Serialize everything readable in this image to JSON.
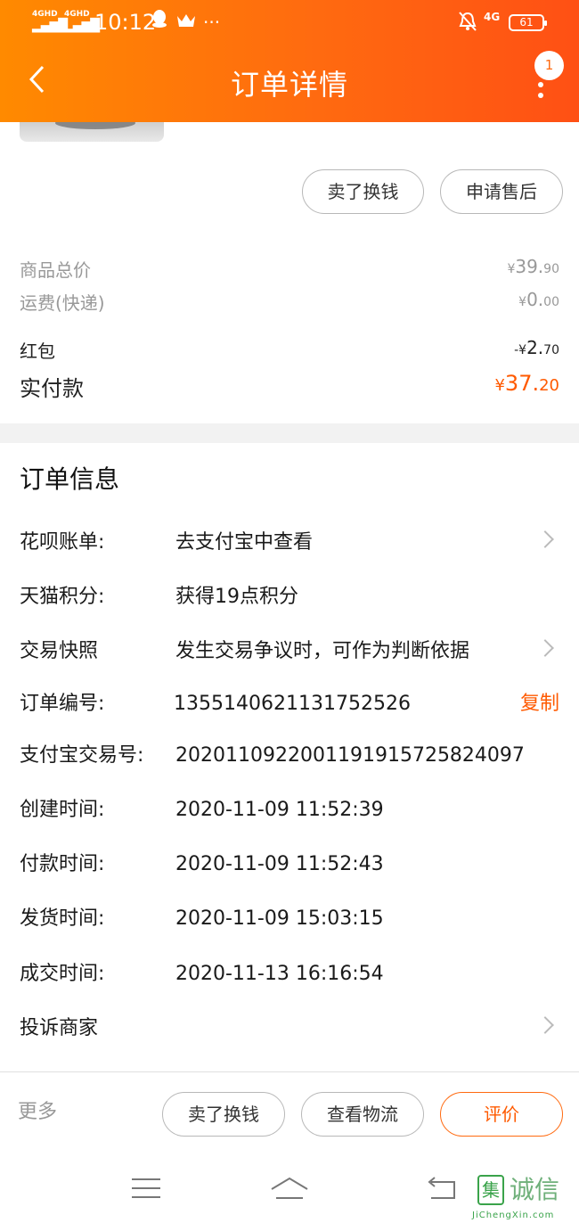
{
  "status_bar": {
    "sig1": "4GHD",
    "sig2": "4GHD",
    "time": "10:12",
    "more": "···",
    "network": "4G",
    "battery": "61"
  },
  "header": {
    "title": "订单详情",
    "back_icon": "chevron-left-icon",
    "more_icon": "vertical-dots-icon",
    "badge": "1"
  },
  "actions_top": {
    "sell_label": "卖了换钱",
    "after_sale_label": "申请售后"
  },
  "prices": {
    "goods_total_label": "商品总价",
    "goods_total_yen": "¥",
    "goods_total_int": "39.",
    "goods_total_dec": "90",
    "shipping_label": "运费(快递)",
    "shipping_yen": "¥",
    "shipping_int": "0.",
    "shipping_dec": "00",
    "redpacket_label": "红包",
    "redpacket_yen": "-¥",
    "redpacket_int": "2.",
    "redpacket_dec": "70",
    "paid_label": "实付款",
    "paid_yen": "¥",
    "paid_int": "37.",
    "paid_dec": "20"
  },
  "order_info": {
    "title": "订单信息",
    "rows": [
      {
        "label": "花呗账单:",
        "value": "去支付宝中查看"
      },
      {
        "label": "天猫积分:",
        "value": "获得19点积分"
      },
      {
        "label": "交易快照",
        "value": "发生交易争议时，可作为判断依据"
      },
      {
        "label": "订单编号:",
        "value": "1355140621131752526",
        "action": "复制"
      },
      {
        "label": "支付宝交易号:",
        "value": "2020110922001191915725824097"
      },
      {
        "label": "创建时间:",
        "value": "2020-11-09 11:52:39"
      },
      {
        "label": "付款时间:",
        "value": "2020-11-09 11:52:43"
      },
      {
        "label": "发货时间:",
        "value": "2020-11-09 15:03:15"
      },
      {
        "label": "成交时间:",
        "value": "2020-11-13 16:16:54"
      },
      {
        "label": "投诉商家",
        "value": ""
      }
    ]
  },
  "bottom_bar": {
    "more_label": "更多",
    "sell_label": "卖了换钱",
    "logistics_label": "查看物流",
    "review_label": "评价"
  },
  "watermark": {
    "logo": "集",
    "text": "诚信",
    "url": "JiChengXin.com"
  },
  "colors": {
    "accent": "#ff6a10",
    "header_start": "#ff8a00",
    "header_end": "#ff5014"
  }
}
